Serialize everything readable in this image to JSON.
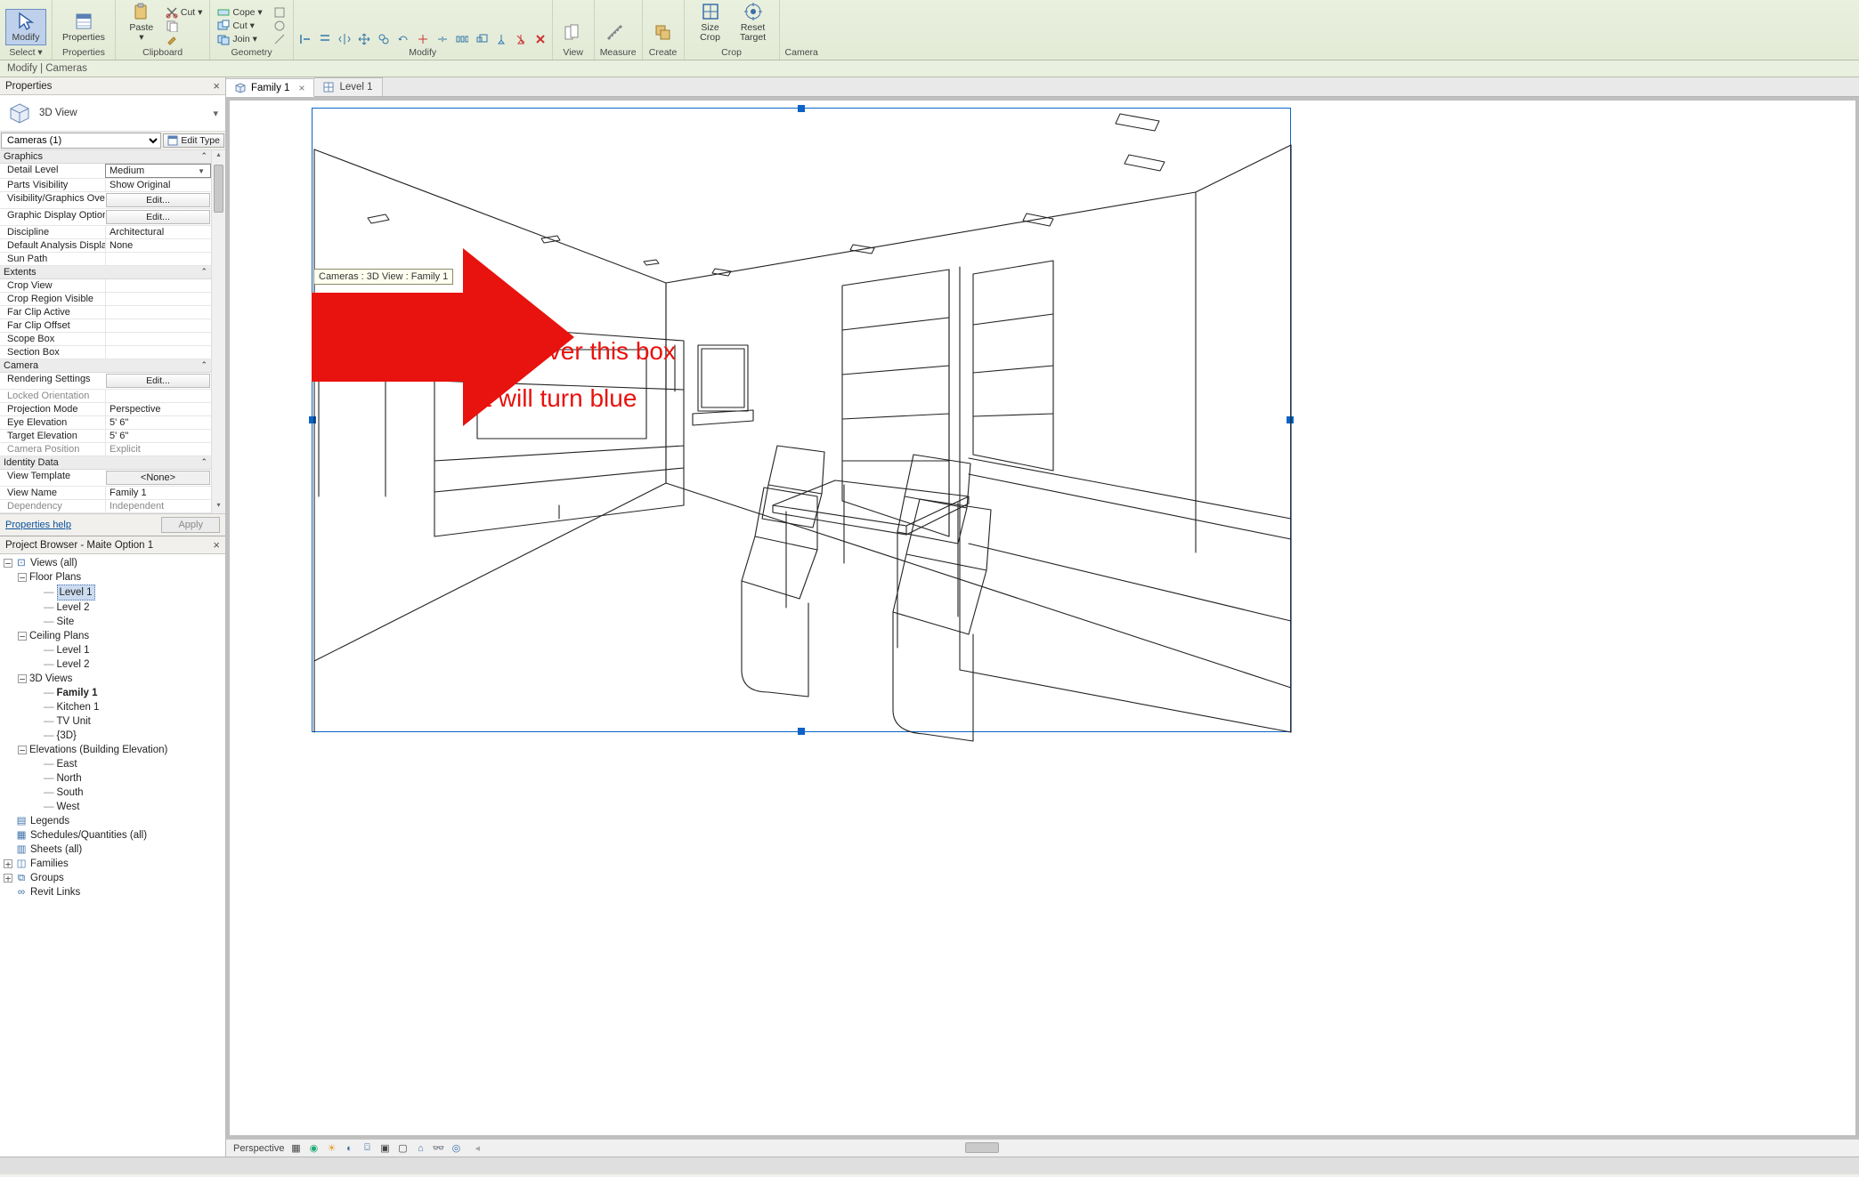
{
  "ribbon": {
    "modify_bar": "Modify | Cameras",
    "groups": {
      "select": {
        "title": "Select ▾",
        "btn": "Modify"
      },
      "properties": {
        "title": "Properties",
        "btn": "Properties"
      },
      "clipboard": {
        "title": "Clipboard",
        "paste": "Paste",
        "cut": "Cut ▾",
        "copy": "",
        "match": ""
      },
      "geometry": {
        "title": "Geometry",
        "cope": "Cope ▾",
        "join": "Join ▾",
        "cut2": "Cut ▾"
      },
      "modify": {
        "title": "Modify"
      },
      "view": {
        "title": "View"
      },
      "measure": {
        "title": "Measure"
      },
      "create": {
        "title": "Create"
      },
      "crop": {
        "title": "Crop",
        "size": "Size\nCrop",
        "reset": "Reset\nTarget"
      },
      "camera": {
        "title": "Camera"
      }
    }
  },
  "properties_panel": {
    "title": "Properties",
    "type_name": "3D View",
    "instance_selector": "Cameras (1)",
    "edit_type": "Edit Type",
    "groups": [
      {
        "name": "Graphics",
        "rows": [
          {
            "k": "Detail Level",
            "v": "Medium",
            "type": "combo"
          },
          {
            "k": "Parts Visibility",
            "v": "Show Original"
          },
          {
            "k": "Visibility/Graphics Overrides",
            "v": "Edit...",
            "type": "btn"
          },
          {
            "k": "Graphic Display Options",
            "v": "Edit...",
            "type": "btn"
          },
          {
            "k": "Discipline",
            "v": "Architectural"
          },
          {
            "k": "Default Analysis Display Style",
            "v": "None"
          },
          {
            "k": "Sun Path",
            "v": ""
          }
        ]
      },
      {
        "name": "Extents",
        "rows": [
          {
            "k": "Crop View",
            "v": ""
          },
          {
            "k": "Crop Region Visible",
            "v": ""
          },
          {
            "k": "Far Clip Active",
            "v": ""
          },
          {
            "k": "Far Clip Offset",
            "v": ""
          },
          {
            "k": "Scope Box",
            "v": ""
          },
          {
            "k": "Section Box",
            "v": ""
          }
        ]
      },
      {
        "name": "Camera",
        "rows": [
          {
            "k": "Rendering Settings",
            "v": "Edit...",
            "type": "btn"
          },
          {
            "k": "Locked Orientation",
            "v": "",
            "ro": true
          },
          {
            "k": "Projection Mode",
            "v": "Perspective"
          },
          {
            "k": "Eye Elevation",
            "v": "5'  6\""
          },
          {
            "k": "Target Elevation",
            "v": "5'  6\""
          },
          {
            "k": "Camera Position",
            "v": "Explicit",
            "ro": true
          }
        ]
      },
      {
        "name": "Identity Data",
        "rows": [
          {
            "k": "View Template",
            "v": "<None>",
            "type": "none"
          },
          {
            "k": "View Name",
            "v": "Family 1"
          },
          {
            "k": "Dependency",
            "v": "Independent",
            "ro": true
          }
        ]
      }
    ],
    "help": "Properties help",
    "apply": "Apply"
  },
  "browser": {
    "title": "Project Browser - Maite Option 1",
    "tree": [
      {
        "d": 0,
        "tw": "-",
        "ic": "views",
        "t": "Views (all)"
      },
      {
        "d": 1,
        "tw": "-",
        "t": "Floor Plans"
      },
      {
        "d": 2,
        "leaf": true,
        "t": "Level 1",
        "sel": true
      },
      {
        "d": 2,
        "leaf": true,
        "t": "Level 2"
      },
      {
        "d": 2,
        "leaf": true,
        "t": "Site"
      },
      {
        "d": 1,
        "tw": "-",
        "t": "Ceiling Plans"
      },
      {
        "d": 2,
        "leaf": true,
        "t": "Level 1"
      },
      {
        "d": 2,
        "leaf": true,
        "t": "Level 2"
      },
      {
        "d": 1,
        "tw": "-",
        "t": "3D Views"
      },
      {
        "d": 2,
        "leaf": true,
        "t": "Family 1",
        "bold": true
      },
      {
        "d": 2,
        "leaf": true,
        "t": "Kitchen 1"
      },
      {
        "d": 2,
        "leaf": true,
        "t": "TV Unit"
      },
      {
        "d": 2,
        "leaf": true,
        "t": "{3D}"
      },
      {
        "d": 1,
        "tw": "-",
        "t": "Elevations (Building Elevation)"
      },
      {
        "d": 2,
        "leaf": true,
        "t": "East"
      },
      {
        "d": 2,
        "leaf": true,
        "t": "North"
      },
      {
        "d": 2,
        "leaf": true,
        "t": "South"
      },
      {
        "d": 2,
        "leaf": true,
        "t": "West"
      },
      {
        "d": 0,
        "ic": "legend",
        "t": "Legends"
      },
      {
        "d": 0,
        "ic": "sched",
        "t": "Schedules/Quantities (all)"
      },
      {
        "d": 0,
        "ic": "sheet",
        "t": "Sheets (all)"
      },
      {
        "d": 0,
        "tw": "+",
        "ic": "fam",
        "t": "Families"
      },
      {
        "d": 0,
        "tw": "+",
        "ic": "grp",
        "t": "Groups"
      },
      {
        "d": 0,
        "ic": "link",
        "t": "Revit Links"
      }
    ]
  },
  "tabs": [
    {
      "label": "Family 1",
      "active": true,
      "closeable": true,
      "icon": "cube"
    },
    {
      "label": "Level 1",
      "active": false,
      "closeable": false,
      "icon": "plan"
    }
  ],
  "tooltip": "Cameras : 3D View : Family 1",
  "annotation": {
    "l1": "click over this box",
    "l2": "it will turn blue"
  },
  "view_status": {
    "mode": "Perspective"
  }
}
